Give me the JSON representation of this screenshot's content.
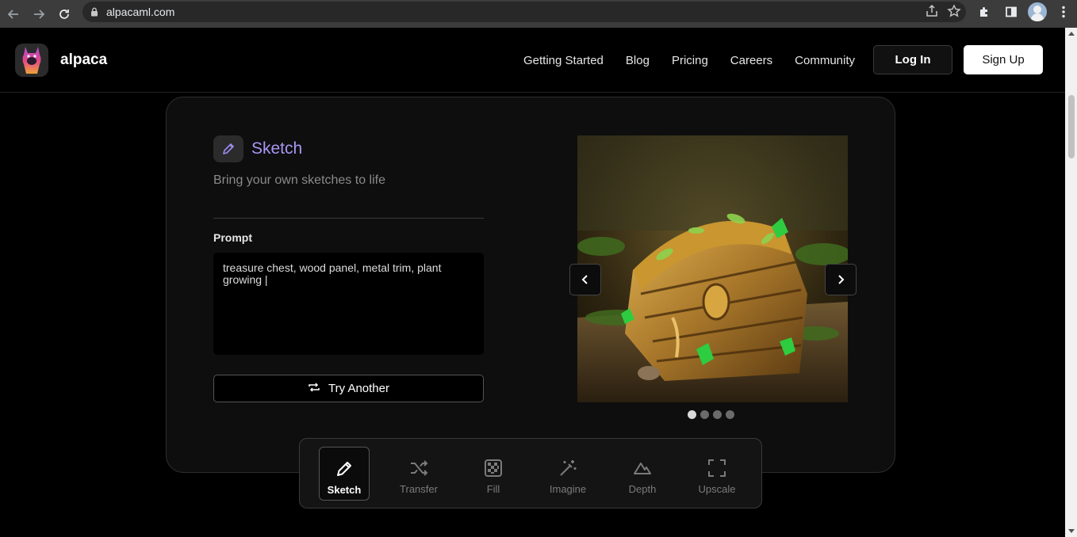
{
  "browser": {
    "url": "alpacaml.com"
  },
  "header": {
    "brand": "alpaca",
    "nav": [
      "Getting Started",
      "Blog",
      "Pricing",
      "Careers",
      "Community"
    ],
    "login_label": "Log In",
    "signup_label": "Sign Up"
  },
  "feature": {
    "title": "Sketch",
    "subtitle": "Bring your own sketches to life",
    "prompt_label": "Prompt",
    "prompt_value": "treasure chest, wood panel, metal trim, plant growing |",
    "try_label": "Try Another",
    "carousel": {
      "count": 4,
      "active": 0
    }
  },
  "toolbar": {
    "tools": [
      {
        "label": "Sketch",
        "icon": "pencil-icon",
        "active": true
      },
      {
        "label": "Transfer",
        "icon": "shuffle-icon",
        "active": false
      },
      {
        "label": "Fill",
        "icon": "checker-icon",
        "active": false
      },
      {
        "label": "Imagine",
        "icon": "magic-wand-icon",
        "active": false
      },
      {
        "label": "Depth",
        "icon": "mountain-icon",
        "active": false
      },
      {
        "label": "Upscale",
        "icon": "expand-icon",
        "active": false
      }
    ]
  },
  "colors": {
    "accent": "#a896f5",
    "background": "#000000",
    "card": "#0e0e0e"
  }
}
